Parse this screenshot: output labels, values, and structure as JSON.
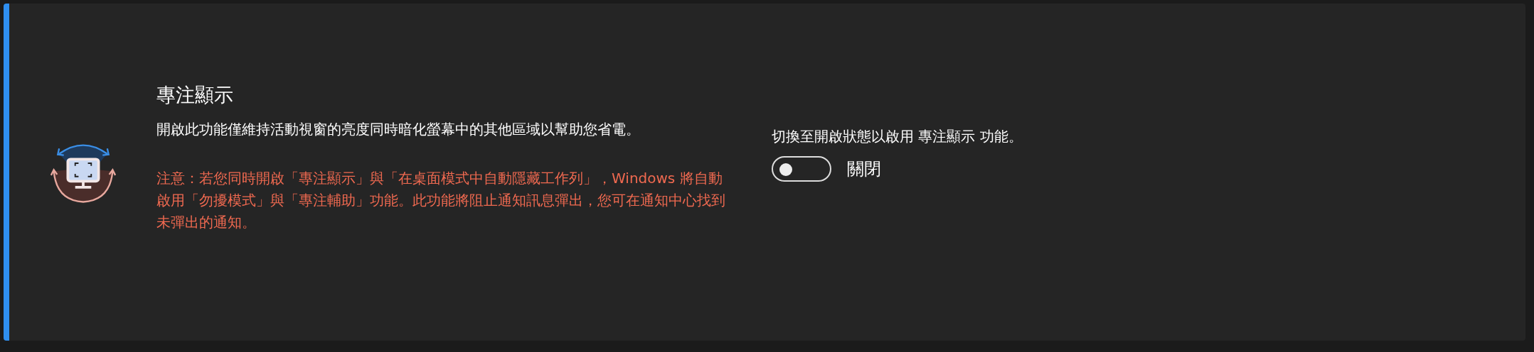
{
  "title": "專注顯示",
  "description": "開啟此功能僅維持活動視窗的亮度同時暗化螢幕中的其他區域以幫助您省電。",
  "warning": "注意：若您同時開啟「專注顯示」與「在桌面模式中自動隱藏工作列」，Windows 將自動啟用「勿擾模式」與「專注輔助」功能。此功能將阻止通知訊息彈出，您可在通知中心找到未彈出的通知。",
  "toggle": {
    "caption": "切換至開啟狀態以啟用 專注顯示 功能。",
    "on": false,
    "state_label": "關閉"
  }
}
